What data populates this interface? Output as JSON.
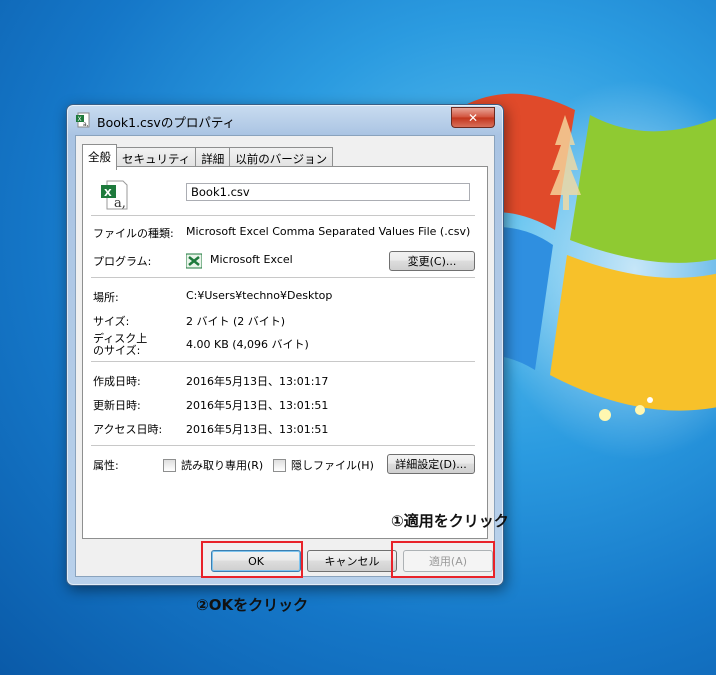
{
  "window": {
    "title": "Book1.csvのプロパティ",
    "close_label": "✕"
  },
  "tabs": [
    {
      "label": "全般"
    },
    {
      "label": "セキュリティ"
    },
    {
      "label": "詳細"
    },
    {
      "label": "以前のバージョン"
    }
  ],
  "general": {
    "filename": "Book1.csv",
    "type_label": "ファイルの種類:",
    "type_value": "Microsoft Excel Comma Separated Values File (.csv)",
    "program_label": "プログラム:",
    "program_value": "Microsoft Excel",
    "change_button": "変更(C)...",
    "location_label": "場所:",
    "location_value": "C:¥Users¥techno¥Desktop",
    "size_label": "サイズ:",
    "size_value": "2 バイト (2 バイト)",
    "disk_size_label_1": "ディスク上",
    "disk_size_label_2": "のサイズ:",
    "disk_size_value": "4.00 KB (4,096 バイト)",
    "created_label": "作成日時:",
    "created_value": "2016年5月13日、13:01:17",
    "modified_label": "更新日時:",
    "modified_value": "2016年5月13日、13:01:51",
    "accessed_label": "アクセス日時:",
    "accessed_value": "2016年5月13日、13:01:51",
    "attributes_label": "属性:",
    "readonly_label": "読み取り専用(R)",
    "hidden_label": "隠しファイル(H)",
    "advanced_button": "詳細設定(D)..."
  },
  "footer": {
    "ok_button": "OK",
    "cancel_button": "キャンセル",
    "apply_button": "適用(A)"
  },
  "annotations": {
    "step1": "①適用をクリック",
    "step2": "②OKをクリック"
  },
  "colors": {
    "highlight": "#e8232a"
  }
}
